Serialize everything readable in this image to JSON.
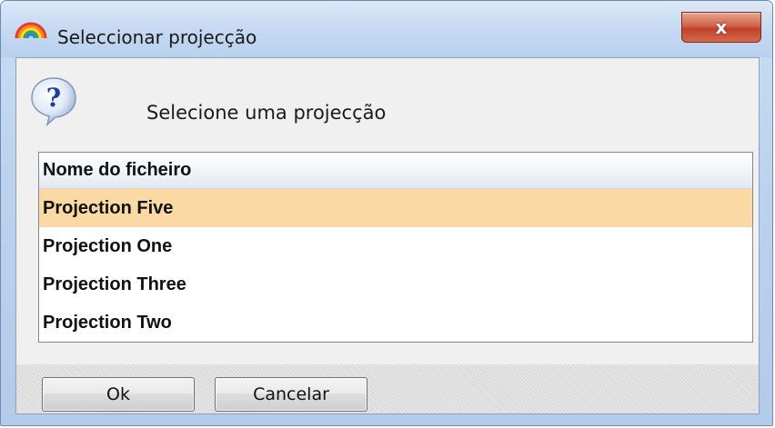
{
  "window": {
    "title": "Seleccionar projecção",
    "close_label": "x"
  },
  "prompt": {
    "text": "Selecione uma projecção",
    "icon": "question-icon"
  },
  "list": {
    "header": "Nome do ficheiro",
    "items": [
      {
        "label": "Projection Five",
        "selected": true
      },
      {
        "label": "Projection One",
        "selected": false
      },
      {
        "label": "Projection Three",
        "selected": false
      },
      {
        "label": "Projection Two",
        "selected": false
      }
    ]
  },
  "buttons": {
    "ok_label": "Ok",
    "cancel_label": "Cancelar"
  },
  "colors": {
    "selection": "#fbd9a4",
    "close_button": "#c0412a",
    "title_bar": "#c6daf2"
  }
}
